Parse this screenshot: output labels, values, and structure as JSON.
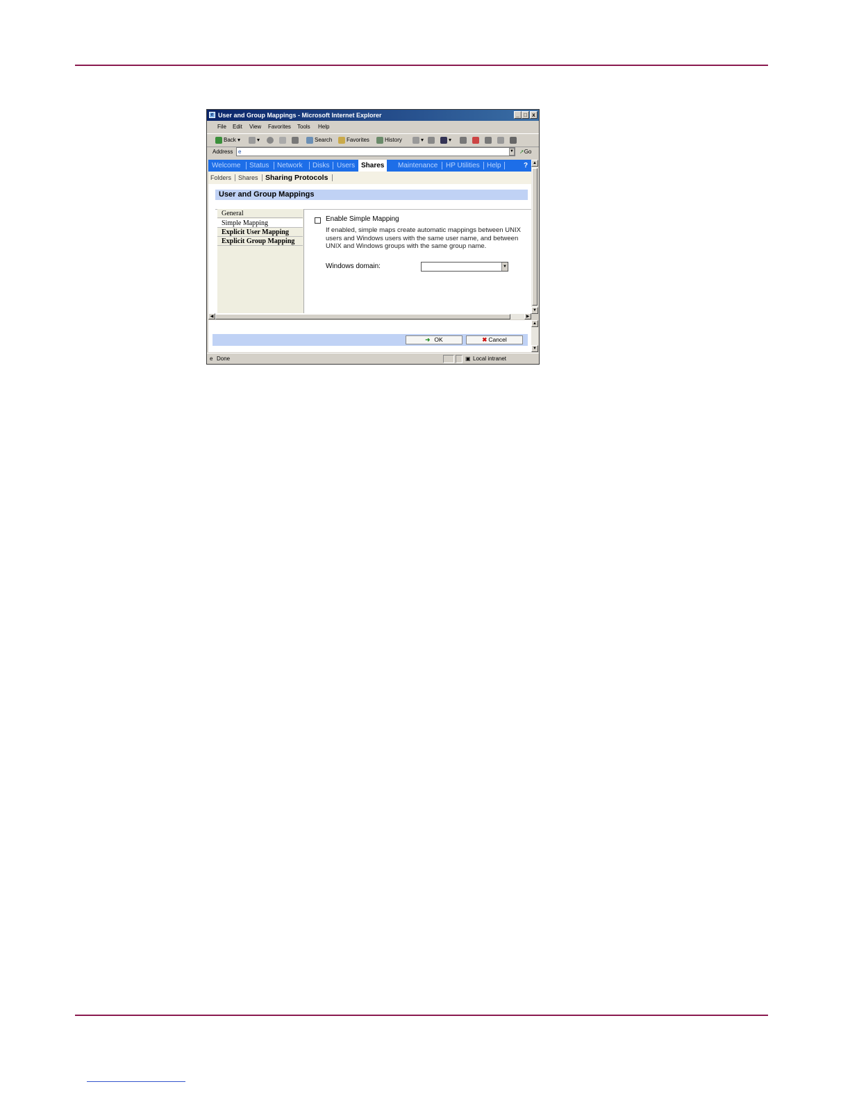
{
  "window": {
    "title": "User and Group Mappings - Microsoft Internet Explorer",
    "minimize": "_",
    "maximize": "□",
    "close": "x"
  },
  "menubar": [
    "File",
    "Edit",
    "View",
    "Favorites",
    "Tools",
    "Help"
  ],
  "toolbar": {
    "back": "Back",
    "search": "Search",
    "favorites": "Favorites",
    "history": "History"
  },
  "address": {
    "label": "Address",
    "value": "",
    "go": "Go"
  },
  "nav": {
    "tabs": [
      "Welcome",
      "Status",
      "Network",
      "Disks",
      "Users",
      "Shares",
      "Maintenance",
      "HP Utilities",
      "Help"
    ],
    "active": "Shares",
    "help_icon": "?"
  },
  "subnav": {
    "items": [
      "Folders",
      "Shares",
      "Sharing Protocols"
    ],
    "active": "Sharing Protocols"
  },
  "page": {
    "title": "User and Group Mappings",
    "side_tabs": [
      "General",
      "Simple Mapping",
      "Explicit User Mapping",
      "Explicit Group Mapping"
    ],
    "selected_tab": "Simple Mapping",
    "enable_label": "Enable Simple Mapping",
    "enable_checked": false,
    "description": "If enabled, simple maps create automatic mappings between UNIX users and Windows users with the same user name, and between UNIX and Windows groups with the same group name.",
    "domain_label": "Windows domain:",
    "domain_value": ""
  },
  "buttons": {
    "ok": "OK",
    "cancel": "Cancel"
  },
  "status": {
    "left": "Done",
    "zone": "Local intranet"
  }
}
